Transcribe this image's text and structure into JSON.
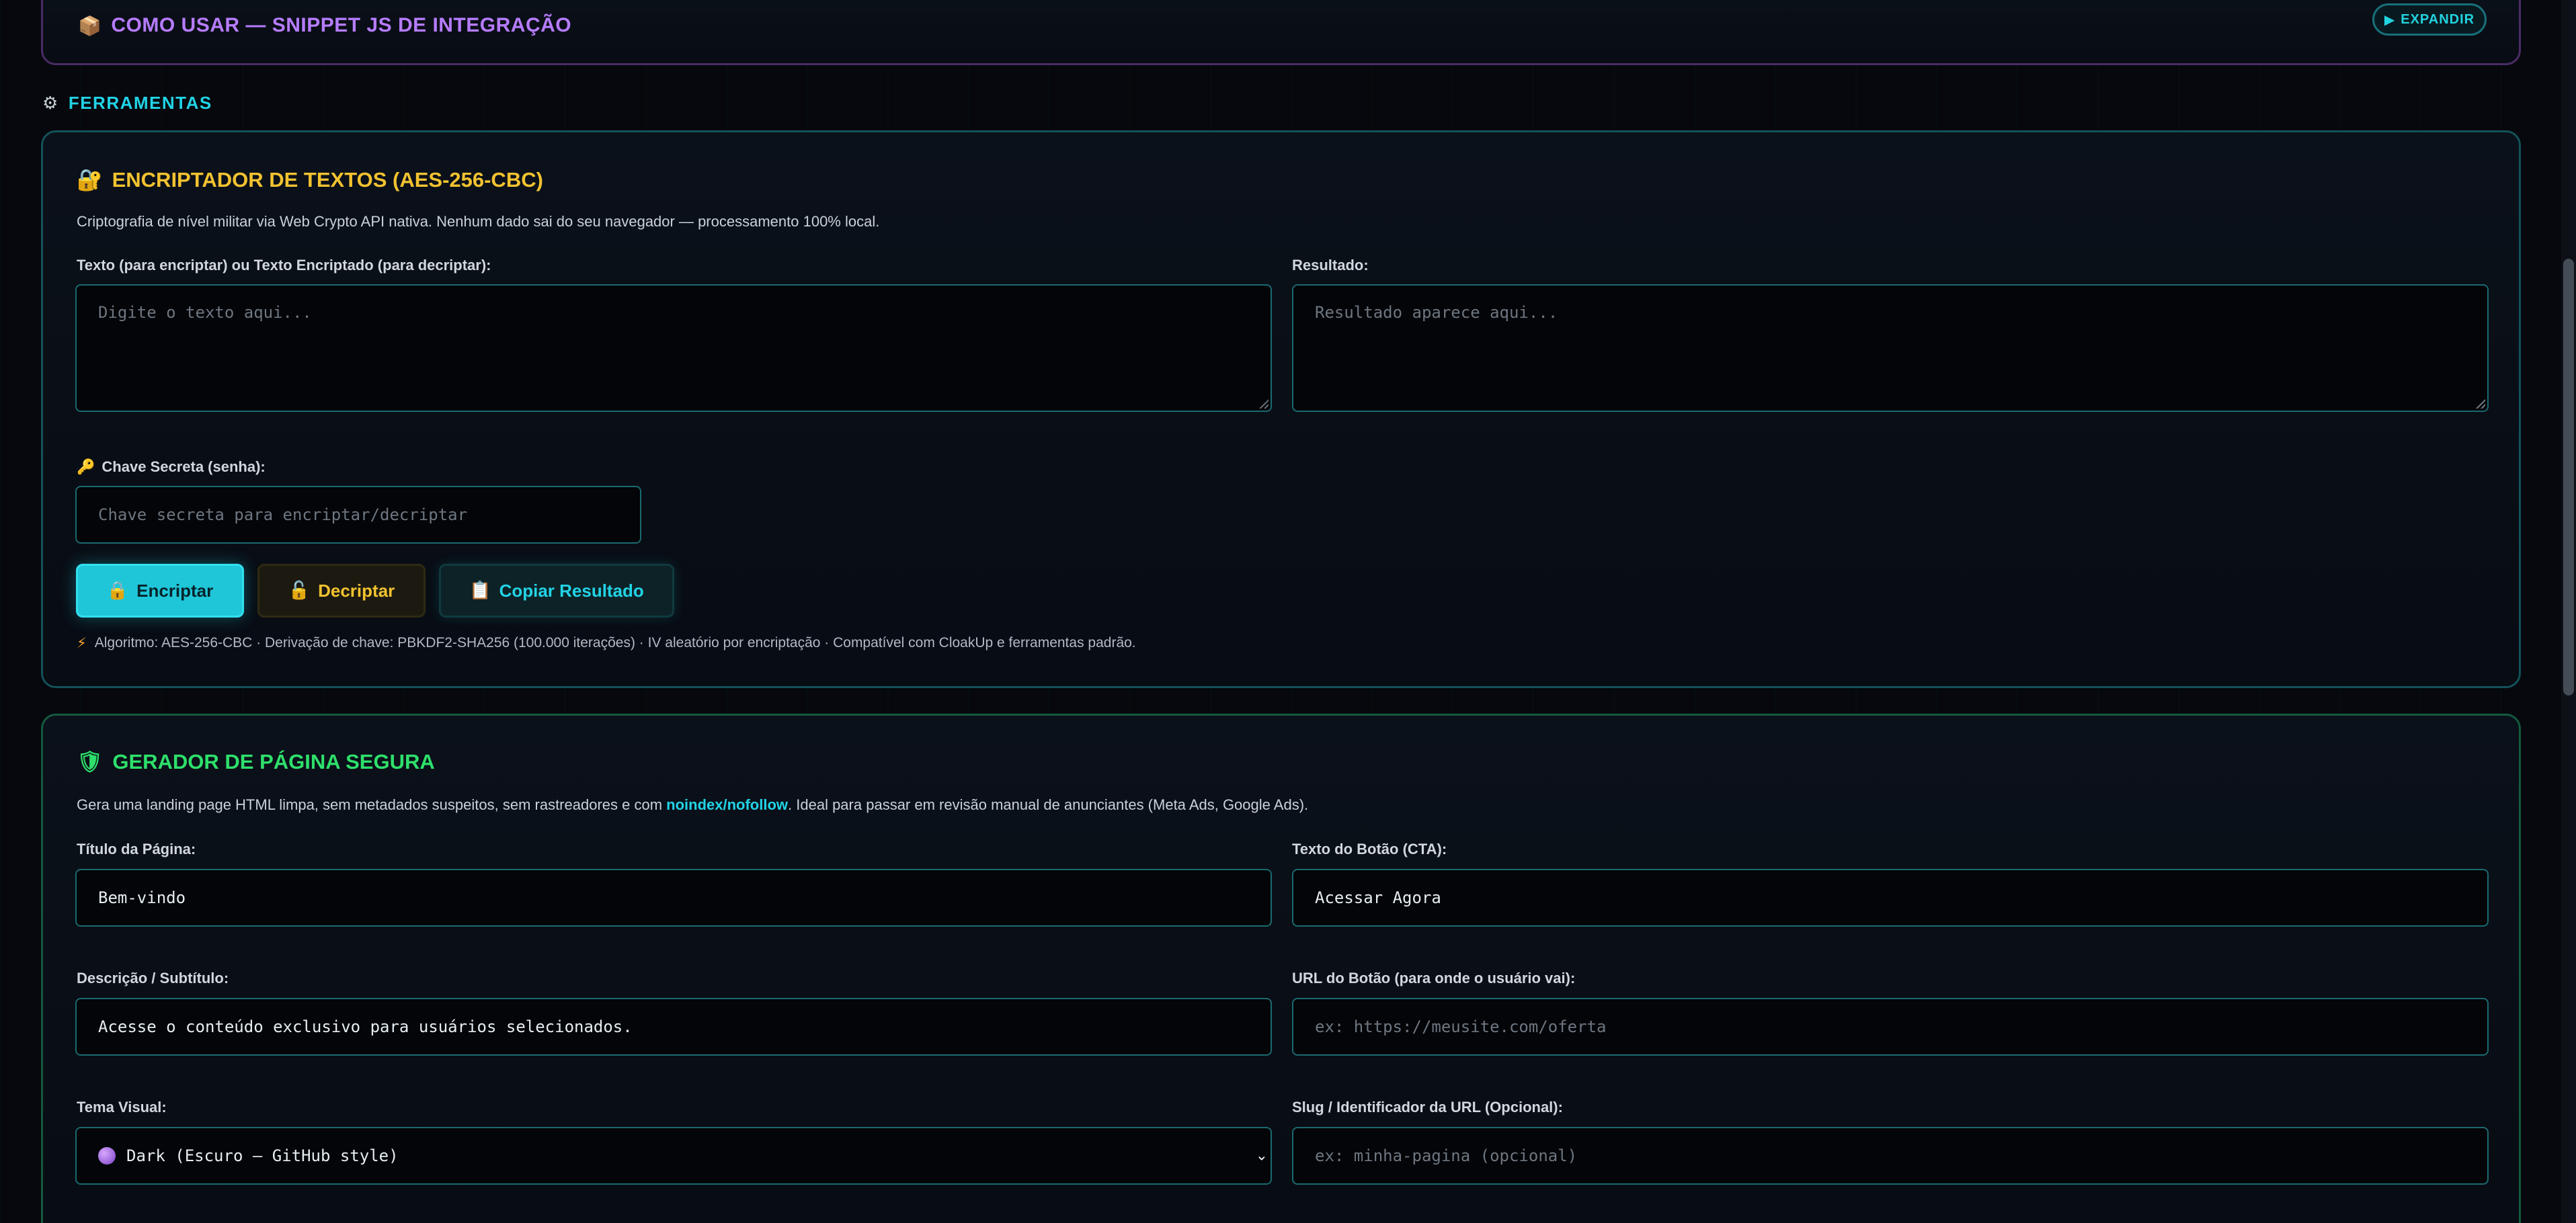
{
  "usage_card": {
    "icon": "package-icon",
    "title": "COMO USAR — SNIPPET JS DE INTEGRAÇÃO",
    "expand_label": "EXPANDIR"
  },
  "tools_section": {
    "icon": "gear-icon",
    "label": "FERRAMENTAS"
  },
  "encryptor": {
    "icon": "lock-icon",
    "title": "ENCRIPTADOR DE TEXTOS (AES-256-CBC)",
    "description": "Criptografia de nível militar via Web Crypto API nativa. Nenhum dado sai do seu navegador — processamento 100% local.",
    "input_label": "Texto (para encriptar) ou Texto Encriptado (para decriptar):",
    "input_placeholder": "Digite o texto aqui...",
    "result_label": "Resultado:",
    "result_placeholder": "Resultado aparece aqui...",
    "key_label": "Chave Secreta (senha):",
    "key_placeholder": "Chave secreta para encriptar/decriptar",
    "encrypt_label": "Encriptar",
    "decrypt_label": "Decriptar",
    "copy_label": "Copiar Resultado",
    "algorithm_note": "Algoritmo: AES-256-CBC · Derivação de chave: PBKDF2-SHA256 (100.000 iterações) · IV aleatório por encriptação · Compatível com CloakUp e ferramentas padrão."
  },
  "generator": {
    "icon": "shield-icon",
    "title": "GERADOR DE PÁGINA SEGURA",
    "description_before": "Gera uma landing page HTML limpa, sem metadados suspeitos, sem rastreadores e com ",
    "description_highlight": "noindex/nofollow",
    "description_after": ". Ideal para passar em revisão manual de anunciantes (Meta Ads, Google Ads).",
    "page_title_label": "Título da Página:",
    "page_title_value": "Bem-vindo",
    "cta_label": "Texto do Botão (CTA):",
    "cta_value": "Acessar Agora",
    "subtitle_label": "Descrição / Subtítulo:",
    "subtitle_value": "Acesse o conteúdo exclusivo para usuários selecionados.",
    "button_url_label": "URL do Botão (para onde o usuário vai):",
    "button_url_placeholder": "ex: https://meusite.com/oferta",
    "theme_label": "Tema Visual:",
    "theme_value": "Dark (Escuro — GitHub style)",
    "slug_label": "Slug / Identificador da URL (Opcional):",
    "slug_placeholder": "ex: minha-pagina (opcional)"
  },
  "colors": {
    "accent_cyan": "#22d3e6",
    "accent_purple": "#b67cff",
    "accent_yellow": "#f2c230",
    "accent_green": "#2ee06b",
    "background": "#06080d"
  }
}
